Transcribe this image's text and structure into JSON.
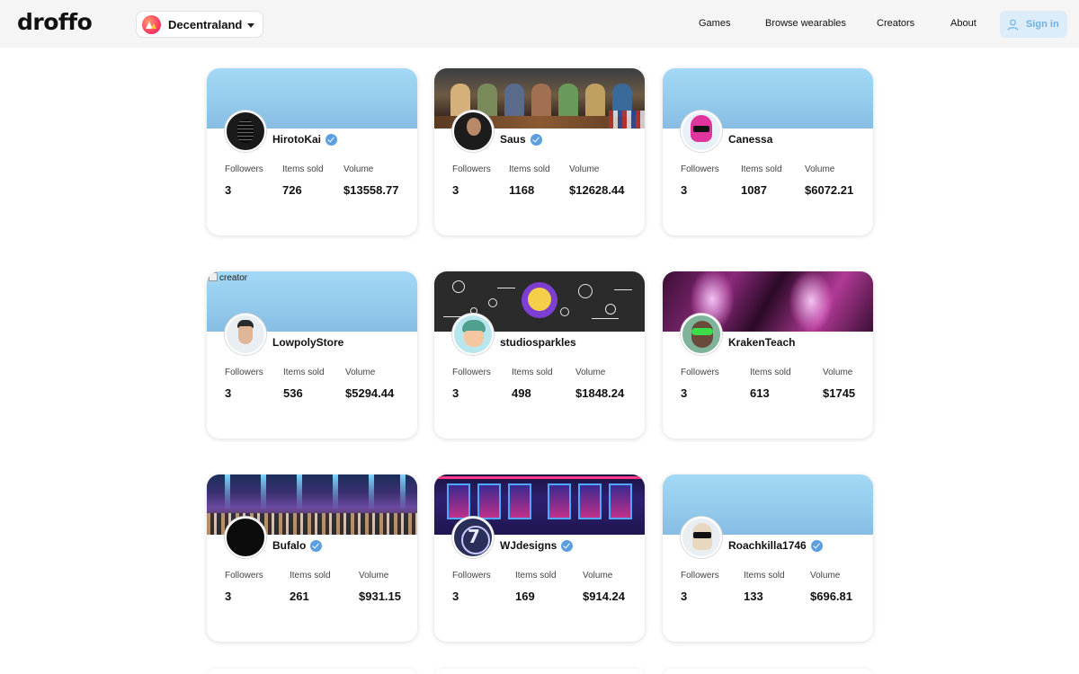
{
  "header": {
    "logo": "droffo",
    "game_selector": {
      "selected": "Decentraland"
    },
    "nav": [
      {
        "label": "Games"
      },
      {
        "label": "Browse wearables"
      },
      {
        "label": "Creators"
      },
      {
        "label": "About"
      }
    ],
    "sign_in_label": "Sign in"
  },
  "stat_labels": {
    "followers": "Followers",
    "items_sold": "Items sold",
    "volume": "Volume"
  },
  "creators": [
    {
      "name": "HirotoKai",
      "verified": true,
      "followers": "3",
      "items_sold": "726",
      "volume": "$13558.77",
      "banner": "plain",
      "avatar": "hiroto"
    },
    {
      "name": "Saus",
      "verified": true,
      "followers": "3",
      "items_sold": "1168",
      "volume": "$12628.44",
      "banner": "saus",
      "avatar": "saus"
    },
    {
      "name": "Canessa",
      "verified": false,
      "followers": "3",
      "items_sold": "1087",
      "volume": "$6072.21",
      "banner": "plain",
      "avatar": "canessa"
    },
    {
      "name": "LowpolyStore",
      "verified": false,
      "followers": "3",
      "items_sold": "536",
      "volume": "$5294.44",
      "banner": "plain",
      "banner_alt_text": "creator",
      "avatar": "lowpoly"
    },
    {
      "name": "studiosparkles",
      "verified": false,
      "followers": "3",
      "items_sold": "498",
      "volume": "$1848.24",
      "banner": "studio",
      "avatar": "studio"
    },
    {
      "name": "KrakenTeach",
      "verified": false,
      "followers": "3",
      "items_sold": "613",
      "volume": "$1745",
      "banner": "kraken",
      "avatar": "kraken"
    },
    {
      "name": "Bufalo",
      "verified": true,
      "followers": "3",
      "items_sold": "261",
      "volume": "$931.15",
      "banner": "bufalo",
      "avatar": "bufalo"
    },
    {
      "name": "WJdesigns",
      "verified": true,
      "followers": "3",
      "items_sold": "169",
      "volume": "$914.24",
      "banner": "wj",
      "avatar": "wj"
    },
    {
      "name": "Roachkilla1746",
      "verified": true,
      "followers": "3",
      "items_sold": "133",
      "volume": "$696.81",
      "banner": "plain",
      "avatar": "roach"
    }
  ],
  "colors": {
    "header_bg": "#f5f5f5",
    "banner_default": "#93c9ea",
    "verified_badge": "#5b9fe0",
    "signin_bg": "#dcecf8",
    "signin_text": "#6fb2e2"
  },
  "icons": {
    "logo": "droffo-logo",
    "game": "decentraland-icon",
    "dropdown": "chevron-down-icon",
    "user": "user-icon",
    "verified": "verified-check-icon"
  }
}
